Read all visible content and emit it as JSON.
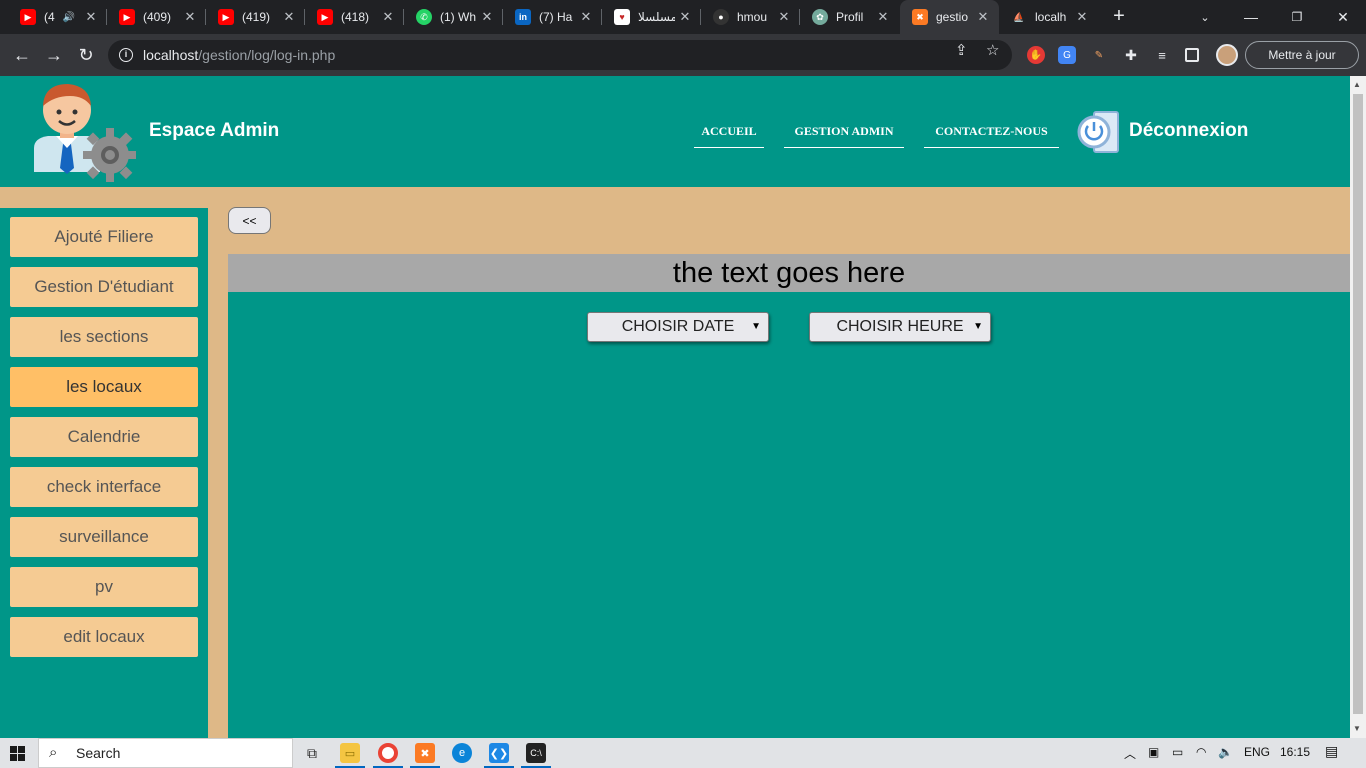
{
  "browser": {
    "tabs": [
      {
        "title": "(4",
        "favicon": "youtube-icon",
        "color": "#ff0000"
      },
      {
        "title": "(409)",
        "favicon": "youtube-icon",
        "color": "#ff0000"
      },
      {
        "title": "(419)",
        "favicon": "youtube-icon",
        "color": "#ff0000"
      },
      {
        "title": "(418)",
        "favicon": "youtube-icon",
        "color": "#ff0000"
      },
      {
        "title": "(1) Wh",
        "favicon": "whatsapp-icon",
        "color": "#25d366"
      },
      {
        "title": "(7) Ha",
        "favicon": "linkedin-icon",
        "color": "#0a66c2"
      },
      {
        "title": "مسلسلا",
        "favicon": "heart-icon",
        "color": "#c62828"
      },
      {
        "title": "hmou",
        "favicon": "github-icon",
        "color": "#333333"
      },
      {
        "title": "Profil",
        "favicon": "openai-icon",
        "color": "#74aa9c"
      },
      {
        "title": "gestio",
        "favicon": "xampp-icon",
        "color": "#fb7a24"
      },
      {
        "title": "localh",
        "favicon": "phpmyadmin-icon",
        "color": "#f89c0e"
      }
    ],
    "url_host": "localhost",
    "url_path": "/gestion/log/log-in.php",
    "update_label": "Mettre à jour"
  },
  "header": {
    "brand": "Espace Admin",
    "nav": [
      {
        "label": "ACCUEIL"
      },
      {
        "label": "GESTION ADMIN"
      },
      {
        "label": "CONTACTEZ-NOUS"
      }
    ],
    "logout": "Déconnexion"
  },
  "sidebar": {
    "items": [
      {
        "label": "Ajouté Filiere"
      },
      {
        "label": "Gestion D'étudiant"
      },
      {
        "label": "les sections"
      },
      {
        "label": "les locaux",
        "active": true
      },
      {
        "label": "Calendrie"
      },
      {
        "label": "check interface"
      },
      {
        "label": "surveillance"
      },
      {
        "label": "pv"
      },
      {
        "label": "edit locaux"
      }
    ]
  },
  "main": {
    "back_label": "<<",
    "title": "the text goes here",
    "date_select": "CHOISIR DATE",
    "hour_select": "CHOISIR HEURE"
  },
  "taskbar": {
    "search_label": "Search",
    "lang": "ENG",
    "time": "16:15"
  },
  "colors": {
    "teal": "#009688",
    "tan": "#deb887",
    "button": "#f5cb93",
    "active_button": "#ffbf66",
    "title_bar": "#a8a8a8"
  }
}
